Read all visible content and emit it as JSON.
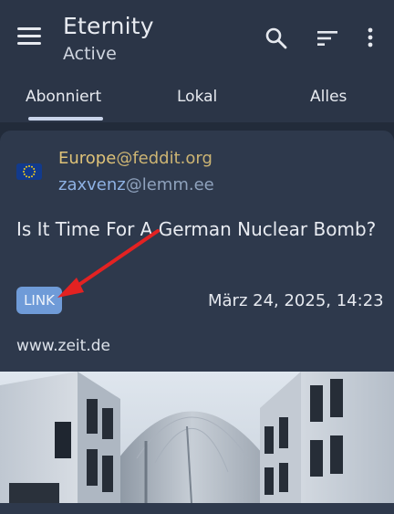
{
  "app": {
    "title": "Eternity",
    "subtitle": "Active"
  },
  "toolbar": {
    "icons": [
      "menu-icon",
      "search-icon",
      "sort-icon",
      "more-vert-icon"
    ]
  },
  "tabs": [
    {
      "label": "Abonniert",
      "active": true
    },
    {
      "label": "Lokal",
      "active": false
    },
    {
      "label": "Alles",
      "active": false
    }
  ],
  "post": {
    "community_name": "Europe",
    "community_host": "@feddit.org",
    "author_name": "zaxvenz",
    "author_host": "@lemm.ee",
    "title": "Is It Time For A German Nuclear Bomb?",
    "badge": "LINK",
    "date": "März 24, 2025, 14:23",
    "domain": "www.zeit.de"
  },
  "colors": {
    "background": "#222b3a",
    "card": "#2e394c",
    "community": "#dec278",
    "author": "#8fb2e4",
    "badge": "#6f9bd8",
    "annotation_arrow": "#e32222"
  }
}
